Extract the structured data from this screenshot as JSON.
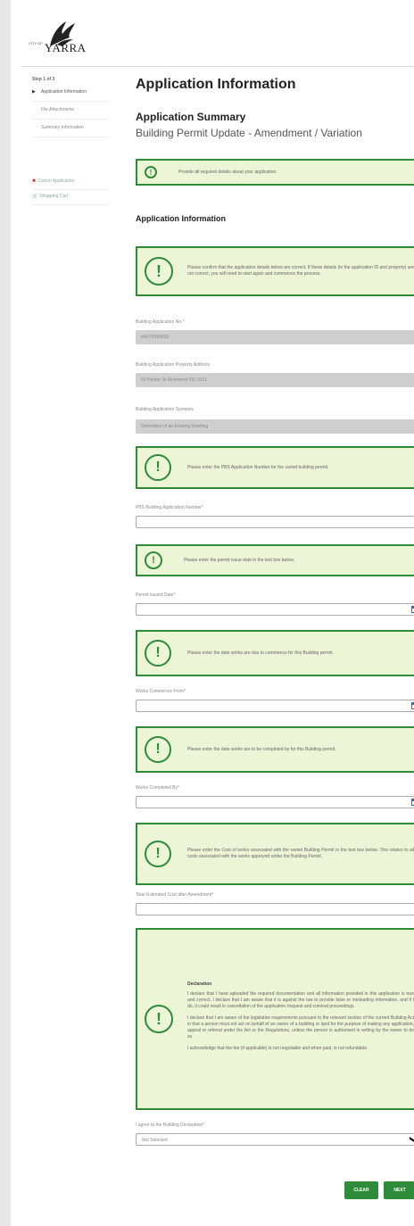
{
  "logo": {
    "small": "CITY OF",
    "text": "YARRA"
  },
  "sidebar": {
    "step": "Step 1 of 3",
    "items": [
      {
        "label": "Application Information"
      },
      {
        "label": "File Attachments"
      },
      {
        "label": "Summary Information"
      }
    ],
    "actions": [
      {
        "label": "Cancel Application",
        "icon": "close-icon"
      },
      {
        "label": "Shopping Cart",
        "icon": "cart-icon"
      }
    ]
  },
  "main": {
    "title": "Application Information",
    "summary_title": "Application Summary",
    "summary_subtitle": "Building Permit Update - Amendment / Variation",
    "info_top": "Provide all required details about your application.",
    "section_title": "Application Information",
    "info_confirm": "Please confirm that the application details below are correct. If these details (ie the application ID and property) are not correct, you will need to start again and commence the process.",
    "fields": {
      "app_no_label": "Building Application No.*",
      "app_no_value": "eA07/0008/02",
      "address_label": "Building Application Property Address",
      "address_value": "53 Hunter St Richmond  VIC  3121",
      "synopsis_label": "Building Application Synopsis",
      "synopsis_value": "Demolition of an Existing Dwelling"
    },
    "info_pbs": "Please enter the PBS Application Number for the varied building permit.",
    "pbs_label": "PBS Building Application Number*",
    "info_issue": "Please enter the permit issue date in the text box below.",
    "issue_label": "Permit Issued Date*",
    "info_commence": "Please enter the date works are due to commence for this Building permit.",
    "commence_label": "Works Commence From*",
    "info_complete": "Please enter the date works are to be completed by for this Building permit.",
    "complete_label": "Works Completed By*",
    "info_cost": "Please enter the Cost of works associated with the varied Building Permit in the text box below. This relates to all costs associated with the works approved under the Building Permit.",
    "cost_label": "Total Estimated Cost after Amendment*",
    "declaration": {
      "title": "Declaration",
      "p1": "I declare that I have uploaded the required documentation and all information provided in this application is true and correct. I declare that I am aware that it is against the law to provide false or misleading information, and if I do, it could result in cancellation of the application /request and criminal proceedings.",
      "p2": "I declare that I am aware of the legislative requirements pursuant to the relevant section of the current Building Act in that a person must not act on behalf of an owner of a building or land for the purpose of making any application, appeal or referral under the Act or the Regulations, unless the person is authorised in writing by the owner to do so.",
      "p3": "I acknowledge that the fee (if applicable) is not negotiable and when paid, is not refundable."
    },
    "agree_label": "I agree to the Building Declaration*",
    "agree_value": "Not Selected",
    "buttons": {
      "clear": "CLEAR",
      "next": "NEXT"
    }
  },
  "colors": {
    "accent": "#2e8b3a",
    "info_bg": "#ecf5d6"
  }
}
